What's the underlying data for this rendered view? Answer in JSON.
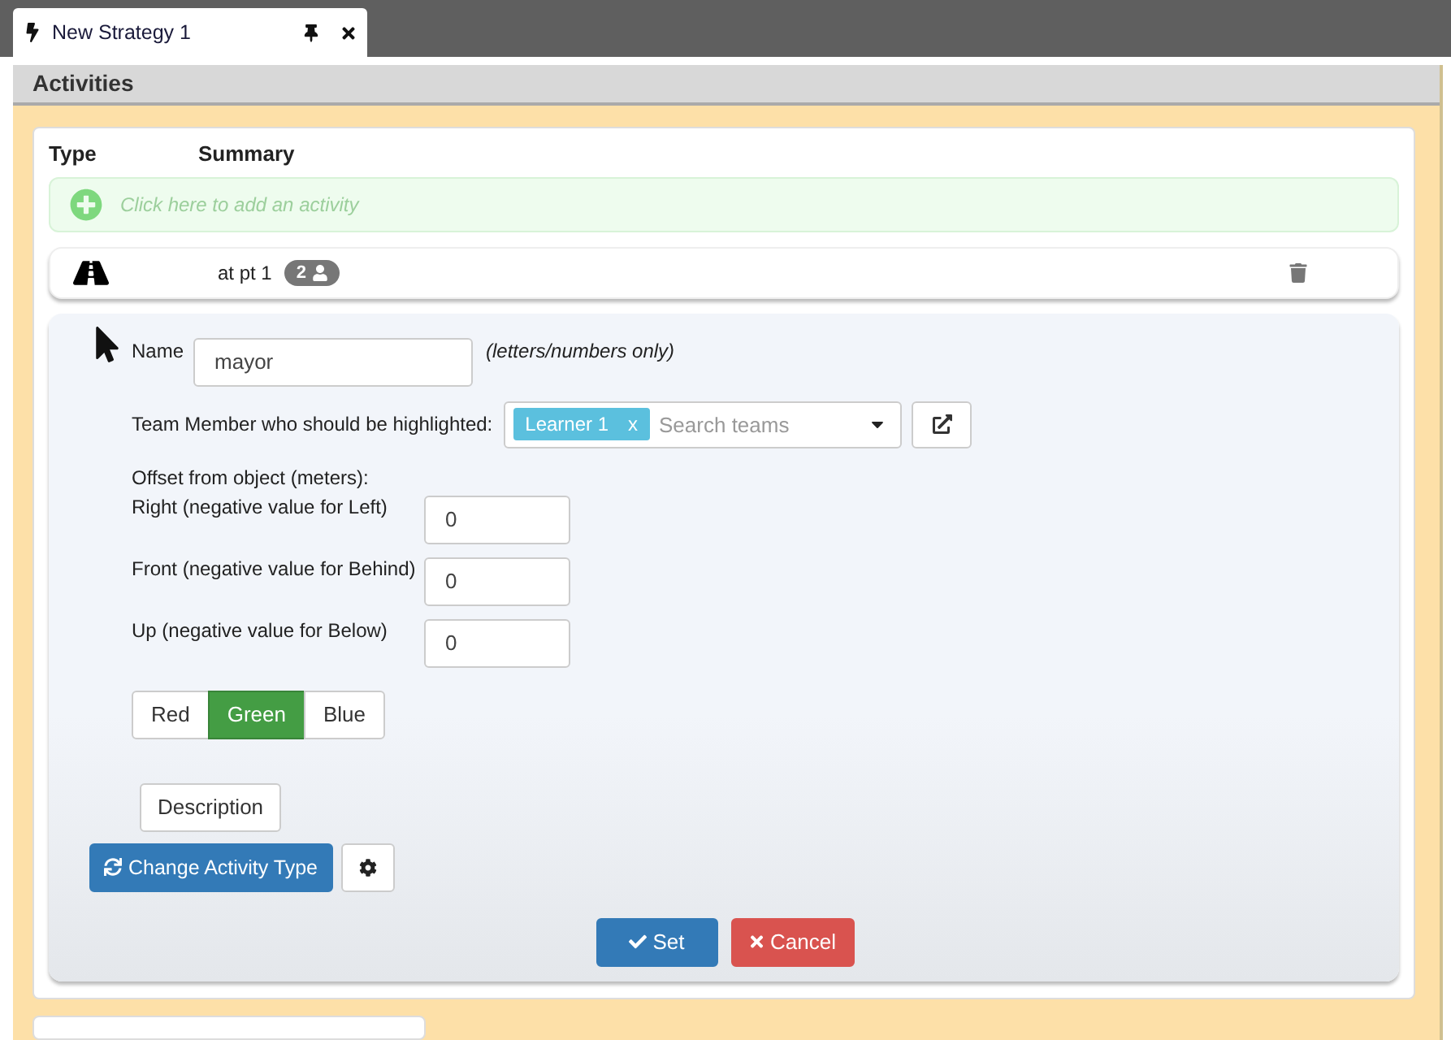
{
  "tab": {
    "title": "New Strategy 1"
  },
  "panel": {
    "title": "Activities"
  },
  "table": {
    "columns": [
      "Type",
      "Summary"
    ]
  },
  "add_row": {
    "placeholder": "Click here to add an activity"
  },
  "activities": [
    {
      "summary": "at pt 1",
      "badge": "2"
    }
  ],
  "editor": {
    "name_label": "Name",
    "name_value": "mayor",
    "name_hint": "(letters/numbers only)",
    "team_label": "Team Member who should be highlighted:",
    "team_tags": [
      {
        "label": "Learner 1",
        "remove": "x"
      }
    ],
    "team_placeholder": "Search teams",
    "offset_title": "Offset from object (meters):",
    "offsets": [
      {
        "label": "Right (negative value for Left)",
        "value": "0"
      },
      {
        "label": "Front (negative value for Behind)",
        "value": "0"
      },
      {
        "label": "Up (negative value for Below)",
        "value": "0"
      }
    ],
    "colors": [
      {
        "label": "Red",
        "selected": false
      },
      {
        "label": "Green",
        "selected": true
      },
      {
        "label": "Blue",
        "selected": false
      }
    ],
    "description_button": "Description",
    "change_type_button": "Change Activity Type",
    "set_button": "Set",
    "cancel_button": "Cancel"
  }
}
